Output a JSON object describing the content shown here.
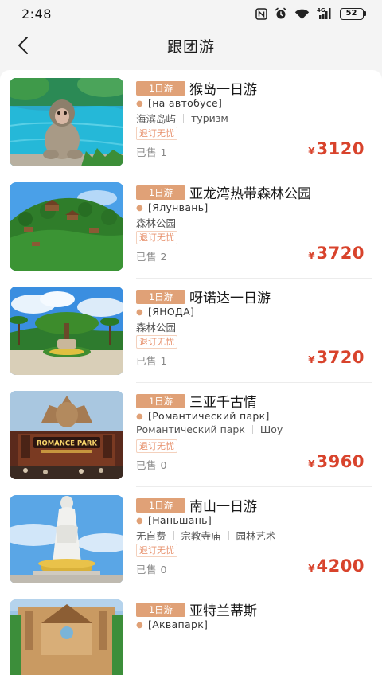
{
  "status_bar": {
    "time": "2:48",
    "network": "4G",
    "battery": "52"
  },
  "nav": {
    "title": "跟团游"
  },
  "currency_symbol": "¥",
  "tours": [
    {
      "days": "1日游",
      "name": "猴岛一日游",
      "subtitle": "[на автобусе]",
      "tags": [
        "海滨岛屿",
        "туризм"
      ],
      "refund": "退订无忧",
      "sold": "已售 1",
      "price": "3120"
    },
    {
      "days": "1日游",
      "name": "亚龙湾热带森林公园",
      "subtitle": "[Ялунвань]",
      "tags": [
        "森林公园"
      ],
      "refund": "退订无忧",
      "sold": "已售 2",
      "price": "3720"
    },
    {
      "days": "1日游",
      "name": "呀诺达一日游",
      "subtitle": "[ЯНОДА]",
      "tags": [
        "森林公园"
      ],
      "refund": "退订无忧",
      "sold": "已售 1",
      "price": "3720"
    },
    {
      "days": "1日游",
      "name": "三亚千古情",
      "subtitle": "[Романтический парк]",
      "tags": [
        "Романтический парк",
        "Шоу"
      ],
      "refund": "退订无忧",
      "sold": "已售 0",
      "price": "3960"
    },
    {
      "days": "1日游",
      "name": "南山一日游",
      "subtitle": "[Наньшань]",
      "tags": [
        "无自费",
        "宗教寺庙",
        "园林艺术"
      ],
      "refund": "退订无忧",
      "sold": "已售 0",
      "price": "4200"
    },
    {
      "days": "1日游",
      "name": "亚特兰蒂斯",
      "subtitle": "[Аквапарк]",
      "tags": [],
      "refund": "",
      "sold": "",
      "price": ""
    }
  ],
  "image_labels": {
    "romance_park": "ROMANCE PARK"
  }
}
